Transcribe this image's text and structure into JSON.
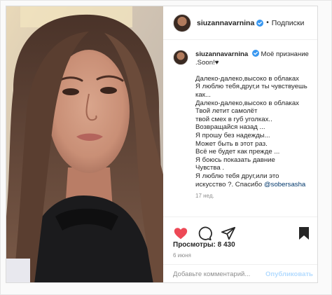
{
  "header": {
    "username": "siuzannavarnina",
    "follow_label": "Подписки"
  },
  "caption": {
    "username": "siuzannavarnina",
    "first_line": "Моё признание",
    "lines": [
      ".Soon!♥",
      "",
      "Далеко-далеко,высоко в облаках",
      "Я люблю тебя,друг,и ты чувствуешь",
      "как...",
      "Далеко-далеко,высоко в облаках",
      "Твой летит самолёт",
      "твой смех в губ уголках..",
      "Возвращайся назад ...",
      "Я прошу без надежды...",
      "Может быть в этот раз.",
      "Всё не будет как прежде ...",
      "Я боюсь показать давние",
      "Чувства .",
      "Я люблю тебя друг,или это",
      "искусство ?. Спасибо"
    ],
    "mention": "@sobersasha",
    "time": "17 нед."
  },
  "stats": {
    "views": "Просмотры: 8 430",
    "date": "6 июня"
  },
  "comment": {
    "placeholder": "Добавьте комментарий...",
    "publish_label": "Опубликовать"
  },
  "icons": {
    "like": "heart-icon",
    "comment": "comment-icon",
    "share": "share-icon",
    "save": "bookmark-icon",
    "verified": "verified-badge-icon"
  },
  "colors": {
    "like": "#ed4956",
    "verified": "#3897f0",
    "mention": "#00376b",
    "publish_disabled": "#b3dbff",
    "muted_text": "#8e8e8e"
  }
}
